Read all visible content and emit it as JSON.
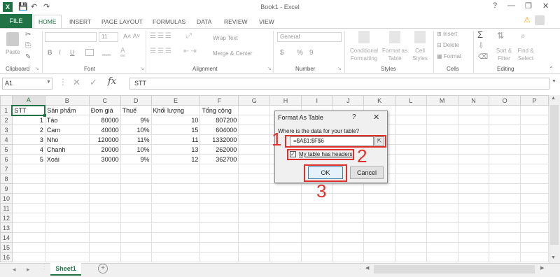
{
  "app": {
    "title": "Book1 - Excel",
    "logo": "X"
  },
  "quick_access": {
    "save_icon": "💾",
    "undo_icon": "↶",
    "redo_icon": "↷"
  },
  "window": {
    "help": "?",
    "minimize": "—",
    "restore": "❐",
    "close": "✕"
  },
  "tabs": [
    "FILE",
    "HOME",
    "INSERT",
    "PAGE LAYOUT",
    "FORMULAS",
    "DATA",
    "REVIEW",
    "VIEW"
  ],
  "ribbon": {
    "clipboard": {
      "paste": "Paste",
      "label": "Clipboard"
    },
    "font": {
      "size": "11",
      "bold": "B",
      "italic": "I",
      "underline": "U",
      "grow": "A˄",
      "shrink": "A˅",
      "label": "Font"
    },
    "alignment": {
      "wrap": "Wrap Text",
      "merge": "Merge & Center",
      "label": "Alignment"
    },
    "number": {
      "format": "General",
      "currency": "$",
      "percent": "%",
      "comma": "9",
      "label": "Number"
    },
    "styles": {
      "conditional": "Conditional Formatting",
      "format_table": "Format as Table",
      "cell_styles": "Cell Styles",
      "label": "Styles"
    },
    "cells": {
      "insert": "Insert",
      "delete": "Delete",
      "format": "Format",
      "label": "Cells"
    },
    "editing": {
      "sum": "Σ",
      "sort": "Sort & Filter",
      "find": "Find & Select",
      "label": "Editing"
    }
  },
  "formula_bar": {
    "name_box": "A1",
    "fx": "fx",
    "content": "STT"
  },
  "columns": [
    "A",
    "B",
    "C",
    "D",
    "E",
    "F",
    "G",
    "H",
    "I",
    "J",
    "K",
    "L",
    "M",
    "N",
    "O",
    "P"
  ],
  "rows": [
    [
      "STT",
      "Sản phẩm",
      "Đơn giá",
      "Thuế",
      "Khối lượng",
      "Tổng cộng"
    ],
    [
      "1",
      "Táo",
      "80000",
      "9%",
      "10",
      "807200"
    ],
    [
      "2",
      "Cam",
      "40000",
      "10%",
      "15",
      "604000"
    ],
    [
      "3",
      "Nho",
      "120000",
      "11%",
      "11",
      "1332000"
    ],
    [
      "4",
      "Chanh",
      "20000",
      "10%",
      "13",
      "262000"
    ],
    [
      "5",
      "Xoài",
      "30000",
      "9%",
      "12",
      "362700"
    ]
  ],
  "row_numbers": [
    "1",
    "2",
    "3",
    "4",
    "5",
    "6",
    "7",
    "8",
    "9",
    "10",
    "11",
    "12",
    "13",
    "14",
    "15",
    "16"
  ],
  "sheet": {
    "tab": "Sheet1",
    "add": "+"
  },
  "dialog": {
    "title": "Format As Table",
    "help": "?",
    "close": "✕",
    "prompt": "Where is the data for your table?",
    "range": "=$A$1:$F$6",
    "checkbox_label": "My table has headers",
    "ok": "OK",
    "cancel": "Cancel"
  },
  "annotations": {
    "one": "1",
    "two": "2",
    "three": "3"
  },
  "colors": {
    "accent": "#217346",
    "annotation": "#e0302c"
  }
}
